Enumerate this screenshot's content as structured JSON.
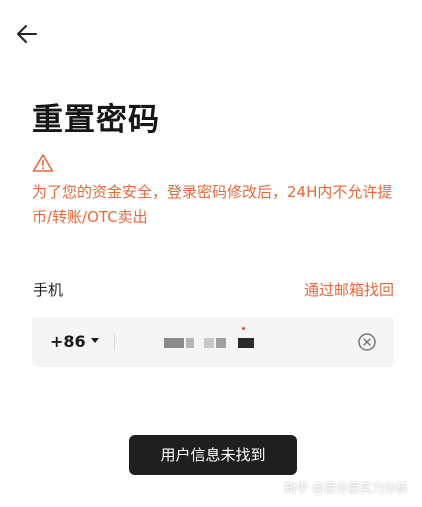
{
  "header": {
    "back_icon": "arrow-left-icon"
  },
  "page": {
    "title": "重置密码"
  },
  "warning": {
    "icon": "warning-triangle-icon",
    "color": "#e8693a",
    "text": "为了您的资金安全，登录密码修改后，24H内不允许提币/转账/OTC卖出"
  },
  "phone": {
    "label": "手机",
    "alt_link": "通过邮箱找回",
    "country_code": "+86",
    "clear_icon": "clear-circle-icon"
  },
  "toast": {
    "message": "用户信息未找到"
  },
  "watermark": {
    "text": "知乎 @百分百实力分析"
  }
}
